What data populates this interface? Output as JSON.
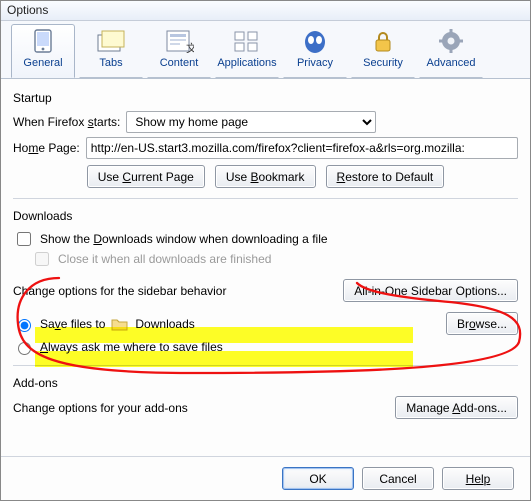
{
  "window": {
    "title": "Options"
  },
  "tabs": {
    "general": "General",
    "tabs": "Tabs",
    "content": "Content",
    "applications": "Applications",
    "privacy": "Privacy",
    "security": "Security",
    "advanced": "Advanced"
  },
  "startup": {
    "heading": "Startup",
    "whenStartsLabel": "When Firefox starts:",
    "whenStartsValue": "Show my home page",
    "homePageLabel": "Home Page:",
    "homePageValue": "http://en-US.start3.mozilla.com/firefox?client=firefox-a&rls=org.mozilla:",
    "useCurrent": "Use Current Page",
    "useBookmark": "Use Bookmark",
    "restoreDefault": "Restore to Default"
  },
  "downloads": {
    "heading": "Downloads",
    "showWindow": "Show the Downloads window when downloading a file",
    "closeWhenDone": "Close it when all downloads are finished",
    "sidebarChange": "Change options for the sidebar behavior",
    "sidebarBtn": "All-in-One Sidebar Options...",
    "saveTo": "Save files to",
    "saveToPath": "Downloads",
    "browse": "Browse...",
    "alwaysAsk": "Always ask me where to save files"
  },
  "addons": {
    "heading": "Add-ons",
    "change": "Change options for your add-ons",
    "manage": "Manage Add-ons..."
  },
  "footer": {
    "ok": "OK",
    "cancel": "Cancel",
    "help": "Help"
  }
}
